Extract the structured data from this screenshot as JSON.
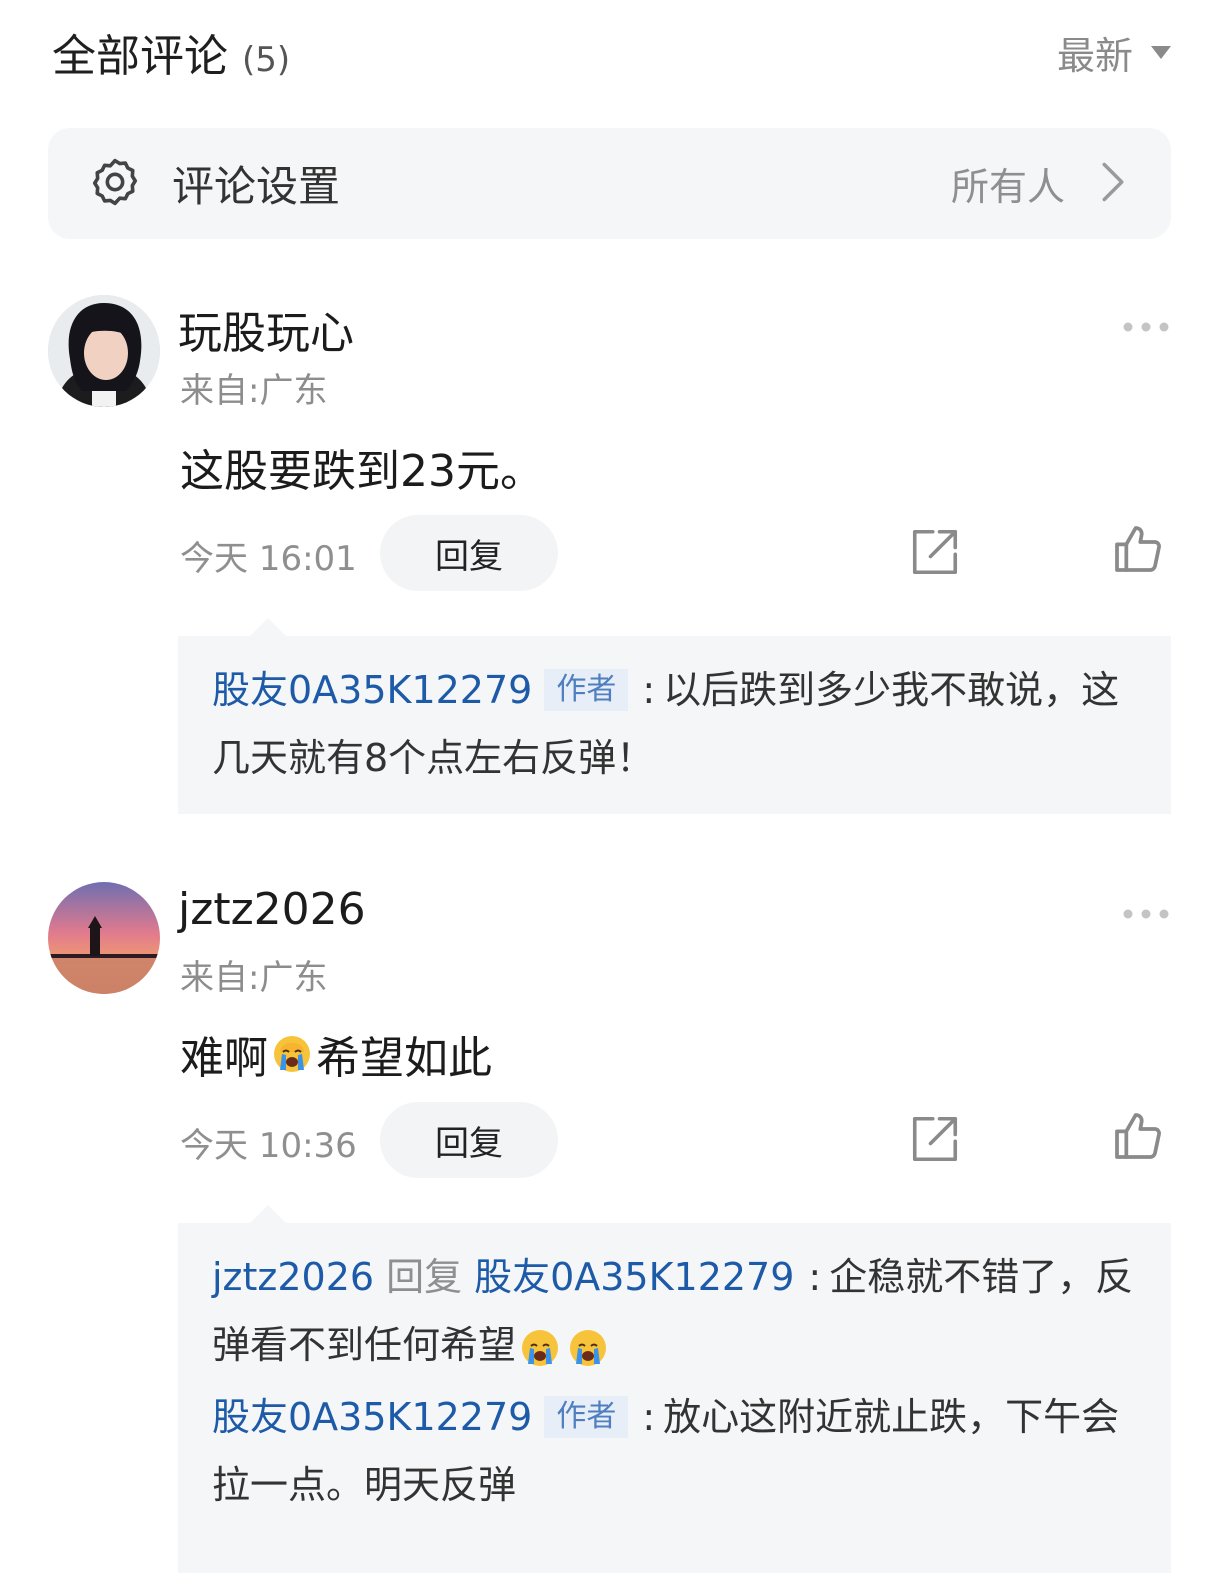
{
  "header": {
    "title": "全部评论",
    "count": "(5)",
    "sort_label": "最新"
  },
  "settings": {
    "label": "评论设置",
    "value": "所有人"
  },
  "comments": [
    {
      "username": "玩股玩心",
      "location": "来自:广东",
      "text": "这股要跌到23元。",
      "time": "今天 16:01",
      "reply_label": "回复",
      "replies": [
        {
          "user": "股友0A35K12279",
          "tag": "作者",
          "separator": ":",
          "text": "以后跌到多少我不敢说，这几天就有8个点左右反弹！"
        }
      ]
    },
    {
      "username": "jztz2026",
      "location": "来自:广东",
      "text_before": "难啊",
      "text_after": "希望如此",
      "emoji": "crying-face",
      "time": "今天 10:36",
      "reply_label": "回复",
      "replies": [
        {
          "user": "jztz2026",
          "verb": "回复",
          "target": "股友0A35K12279",
          "separator": ":",
          "text": "企稳就不错了，反弹看不到任何希望"
        },
        {
          "user": "股友0A35K12279",
          "tag": "作者",
          "separator": ":",
          "text": "放心这附近就止跌，下午会拉一点。明天反弹"
        }
      ]
    }
  ],
  "colors": {
    "link_blue": "#1d5aa8",
    "tag_bg": "#e7eef7",
    "panel_bg": "#f5f6f7",
    "muted_text": "#8f8f8f"
  }
}
